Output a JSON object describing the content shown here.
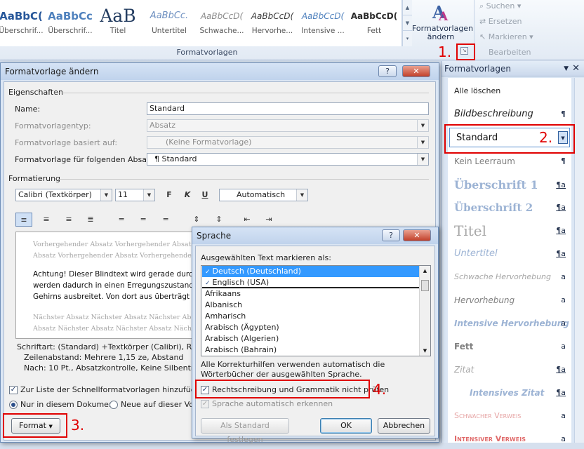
{
  "ribbon": {
    "gallery": [
      {
        "preview": "AaBbC(",
        "label": "Überschrif...",
        "color": "#27579a",
        "size": 15
      },
      {
        "preview": "AaBbCc",
        "label": "Überschrif...",
        "color": "#4f81bd",
        "size": 15
      },
      {
        "preview": "AaB",
        "label": "Titel",
        "color": "#233c60",
        "size": 25
      },
      {
        "preview": "AaBbCc.",
        "label": "Untertitel",
        "color": "#6d8fc0",
        "size": 13
      },
      {
        "preview": "AaBbCcD(",
        "label": "Schwache...",
        "color": "#8b8b8b",
        "size": 12
      },
      {
        "preview": "AaBbCcD(",
        "label": "Hervorhe...",
        "color": "#3b3b3b",
        "size": 12
      },
      {
        "preview": "AaBbCcD(",
        "label": "Intensive ...",
        "color": "#4f81bd",
        "size": 12
      },
      {
        "preview": "AaBbCcD(",
        "label": "Fett",
        "color": "#2a2a2a",
        "size": 12
      }
    ],
    "group_label": "Formatvorlagen",
    "change_styles_label": "Formatvorlagen ändern",
    "edit_group": {
      "search": "Suchen",
      "replace": "Ersetzen",
      "select": "Markieren",
      "label": "Bearbeiten"
    }
  },
  "annotations": {
    "n1": "1.",
    "n2": "2.",
    "n3": "3.",
    "n4": "4."
  },
  "modify_dialog": {
    "title": "Formatvorlage ändern",
    "properties_label": "Eigenschaften",
    "name_label": "Name:",
    "name_value": "Standard",
    "type_label": "Formatvorlagentyp:",
    "type_value": "Absatz",
    "based_label": "Formatvorlage basiert auf:",
    "based_value": "(Keine Formatvorlage)",
    "next_label": "Formatvorlage für folgenden Absatz:",
    "next_value": "¶ Standard",
    "formatting_label": "Formatierung",
    "font": "Calibri (Textkörper)",
    "size": "11",
    "color": "Automatisch",
    "preview_prev1": "Vorhergehender Absatz Vorhergehender Absatz Vorhergehender",
    "preview_prev2": "Absatz Vorhergehender Absatz Vorhergehender",
    "preview_text1": "Achtung! Dieser Blindtext wird gerade durch 1",
    "preview_text2": "werden dadurch in einen Erregungszustand ve",
    "preview_text3": "Gehirns ausbreitet. Von dort aus überträgt sic",
    "preview_next1": "Nächster Absatz Nächster Absatz Nächster Abs",
    "preview_next2": "Absatz Nächster Absatz Nächster Absatz Näch",
    "desc1": "Schriftart: (Standard) +Textkörper (Calibri), Rechts",
    "desc2": "Zeilenabstand:  Mehrere 1,15 ze, Abstand",
    "desc3": "Nach:  10 Pt., Absatzkontrolle, Keine Silbentrenn",
    "quicklist_label": "Zur Liste der Schnellformatvorlagen hinzufügen",
    "only_doc_label": "Nur in diesem Dokument",
    "new_docs_label": "Neue auf dieser Vorla",
    "format_button": "Format"
  },
  "language_dialog": {
    "title": "Sprache",
    "mark_label": "Ausgewählten Text markieren als:",
    "languages": [
      "Deutsch (Deutschland)",
      "Englisch (USA)",
      "Afrikaans",
      "Albanisch",
      "Amharisch",
      "Arabisch (Ägypten)",
      "Arabisch (Algerien)",
      "Arabisch (Bahrain)"
    ],
    "selected_index": 0,
    "info_text": "Alle Korrekturhilfen verwenden automatisch die Wörterbücher der ausgewählten Sprache.",
    "no_proof_label": "Rechtschreibung und Grammatik nicht prüfen",
    "auto_detect_label": "Sprache automatisch erkennen",
    "default_button": "Als Standard festlegen",
    "ok_button": "OK",
    "cancel_button": "Abbrechen"
  },
  "styles_pane": {
    "title": "Formatvorlagen",
    "clear_all": "Alle löschen",
    "items": [
      {
        "label": "Bildbeschreibung",
        "mark": "¶",
        "color": "#222",
        "size": 13,
        "style": "italic",
        "weight": "normal",
        "font": "sans"
      },
      {
        "label": "Standard",
        "mark": "",
        "color": "#111",
        "size": 13,
        "style": "normal",
        "weight": "normal",
        "font": "sans"
      },
      {
        "label": "Kein Leerraum",
        "mark": "¶",
        "color": "#7f7f7f",
        "size": 12,
        "style": "normal",
        "weight": "normal",
        "font": "sans"
      },
      {
        "label": "Überschrift 1",
        "mark": "¶a",
        "color": "#9cb3d4",
        "size": 16,
        "style": "normal",
        "weight": "bold",
        "font": "serif"
      },
      {
        "label": "Überschrift 2",
        "mark": "¶a",
        "color": "#9cb3d4",
        "size": 15,
        "style": "normal",
        "weight": "bold",
        "font": "serif"
      },
      {
        "label": "Titel",
        "mark": "¶a",
        "color": "#a8a8a8",
        "size": 20,
        "style": "normal",
        "weight": "normal",
        "font": "serif"
      },
      {
        "label": "Untertitel",
        "mark": "¶a",
        "color": "#9cb3d4",
        "size": 13,
        "style": "italic",
        "weight": "normal",
        "font": "sans"
      },
      {
        "label": "Schwache Hervorhebung",
        "mark": "a",
        "color": "#a6a6a6",
        "size": 11,
        "style": "italic",
        "weight": "normal",
        "font": "sans"
      },
      {
        "label": "Hervorhebung",
        "mark": "a",
        "color": "#7f7f7f",
        "size": 12,
        "style": "italic",
        "weight": "normal",
        "font": "sans"
      },
      {
        "label": "Intensive Hervorhebung",
        "mark": "a",
        "color": "#9cb3d4",
        "size": 12,
        "style": "italic",
        "weight": "bold",
        "font": "sans"
      },
      {
        "label": "Fett",
        "mark": "a",
        "color": "#7f7f7f",
        "size": 12,
        "style": "normal",
        "weight": "bold",
        "font": "sans"
      },
      {
        "label": "Zitat",
        "mark": "¶a",
        "color": "#a6a6a6",
        "size": 12,
        "style": "italic",
        "weight": "normal",
        "font": "sans"
      },
      {
        "label": "Intensives Zitat",
        "mark": "¶a",
        "color": "#9cb3d4",
        "size": 12,
        "style": "italic",
        "weight": "bold",
        "font": "sans"
      },
      {
        "label": "Schwacher Verweis",
        "mark": "a",
        "color": "#e6a4a4",
        "size": 11,
        "style": "normal",
        "weight": "normal",
        "font": "sans"
      },
      {
        "label": "Intensiver Verweis",
        "mark": "a",
        "color": "#e06b6b",
        "size": 11,
        "style": "normal",
        "weight": "bold",
        "font": "sans"
      }
    ]
  }
}
